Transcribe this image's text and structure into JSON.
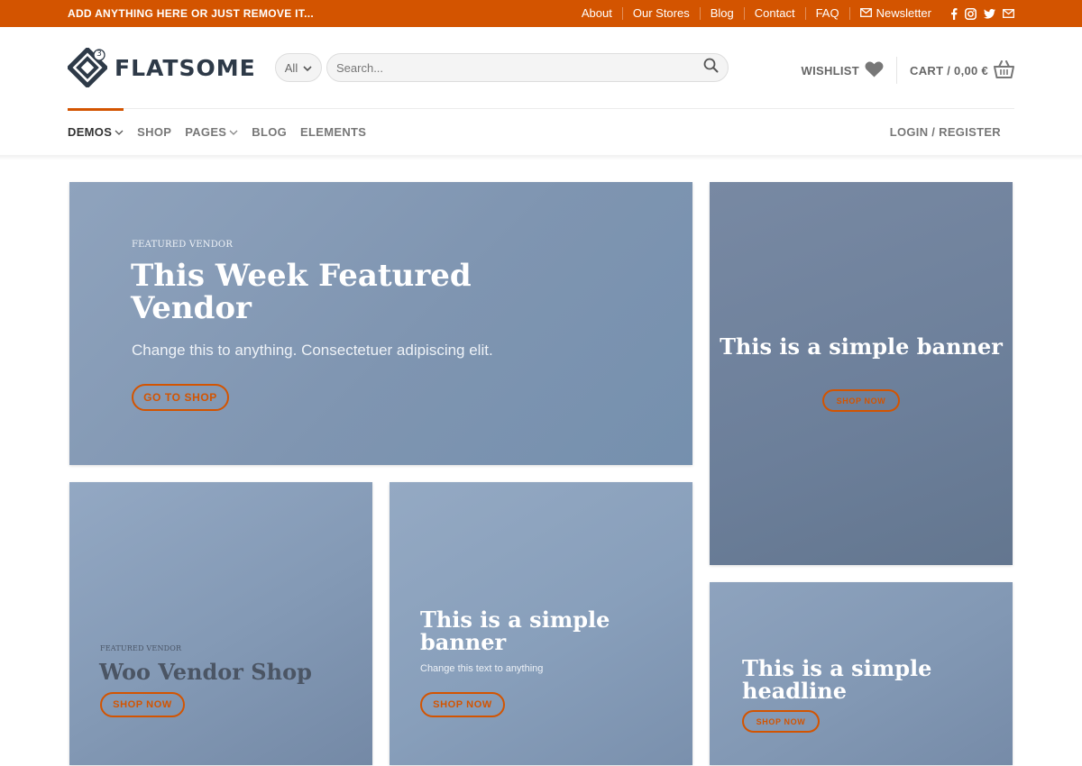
{
  "topbar": {
    "promo": "ADD ANYTHING HERE OR JUST REMOVE IT...",
    "links": [
      "About",
      "Our Stores",
      "Blog",
      "Contact",
      "FAQ"
    ],
    "newsletter": "Newsletter",
    "social_icons": [
      "facebook-icon",
      "instagram-icon",
      "twitter-icon",
      "mail-icon"
    ],
    "bg_color": "#d35400"
  },
  "header": {
    "logo_text": "FLATSOME",
    "logo_badge": "3",
    "category_select": "All",
    "search_placeholder": "Search...",
    "wishlist_label": "WISHLIST",
    "cart_label": "CART / 0,00 €"
  },
  "nav": {
    "items": [
      {
        "label": "DEMOS",
        "dropdown": true,
        "active": true
      },
      {
        "label": "SHOP",
        "dropdown": false
      },
      {
        "label": "PAGES",
        "dropdown": true
      },
      {
        "label": "BLOG",
        "dropdown": false
      },
      {
        "label": "ELEMENTS",
        "dropdown": false
      }
    ],
    "login": "LOGIN / REGISTER"
  },
  "banners": {
    "featured": {
      "kicker": "FEATURED VENDOR",
      "title": "This Week Featured Vendor",
      "subtitle": "Change this to anything. Consectetuer adipiscing elit.",
      "button": "GO TO SHOP"
    },
    "side_top": {
      "title": "This is a simple banner",
      "button": "SHOP NOW"
    },
    "woo": {
      "kicker": "FEATURED VENDOR",
      "title": "Woo Vendor Shop",
      "button": "SHOP NOW"
    },
    "simple": {
      "title": "This is a simple banner",
      "subtitle": "Change this text to anything",
      "button": "SHOP NOW"
    },
    "headline": {
      "title": "This is a simple headline",
      "button": "SHOP NOW"
    }
  },
  "accent_color": "#d35400"
}
